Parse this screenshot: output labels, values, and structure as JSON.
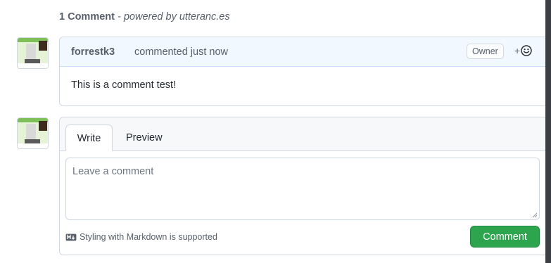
{
  "header": {
    "count": "1 Comment",
    "powered": "- powered by utteranc.es"
  },
  "comment": {
    "author": "forrestk3",
    "action": "commented just now",
    "badge": "Owner",
    "reaction_plus": "+",
    "body": "This is a comment test!"
  },
  "editor": {
    "tab_write": "Write",
    "tab_preview": "Preview",
    "placeholder": "Leave a comment",
    "markdown_note": "Styling with Markdown is supported",
    "submit": "Comment"
  },
  "colors": {
    "accent_green": "#2da44e",
    "header_blue": "#f1f8ff"
  }
}
